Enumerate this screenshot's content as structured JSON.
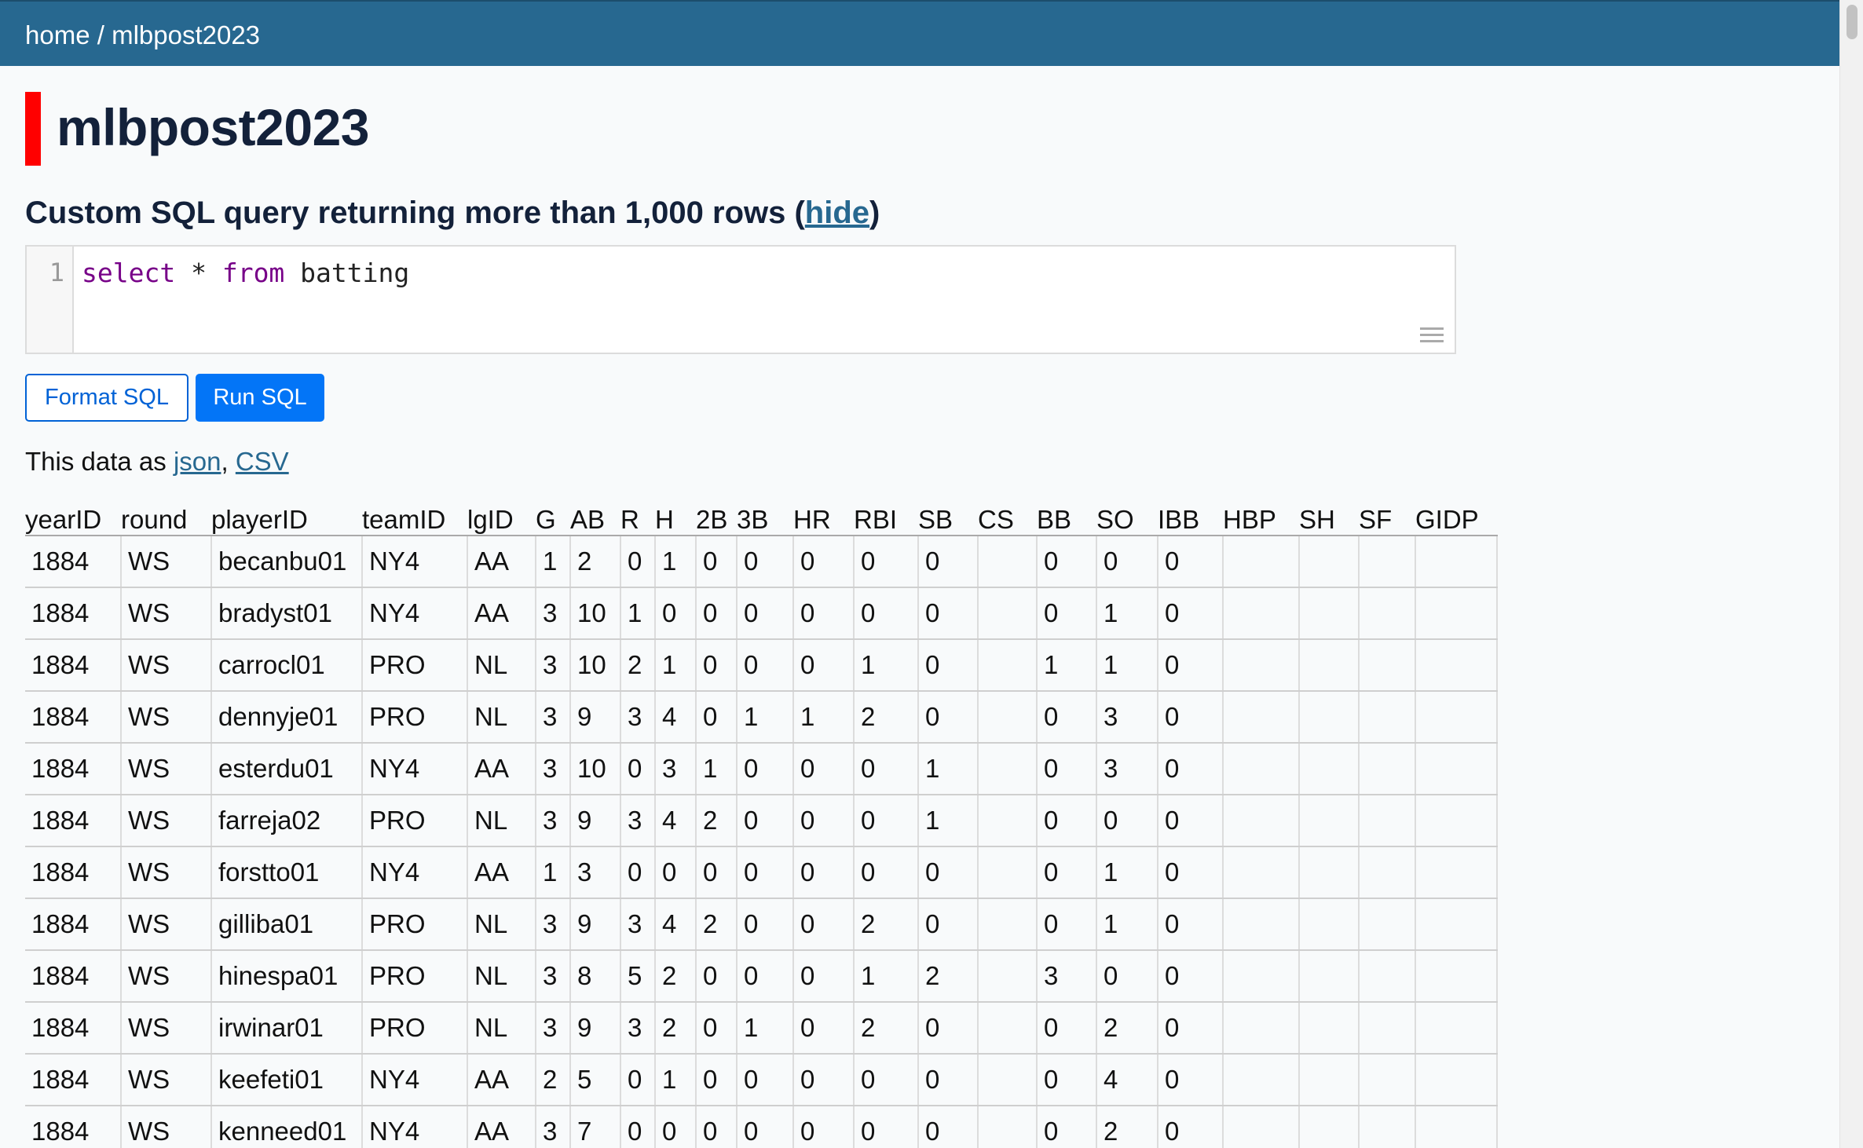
{
  "breadcrumb": {
    "home": "home",
    "separator": " / ",
    "current": "mlbpost2023"
  },
  "page": {
    "title": "mlbpost2023"
  },
  "query": {
    "heading": "Custom SQL query returning more than 1,000 rows (",
    "hide_label": "hide",
    "heading_end": ")",
    "line_number": "1",
    "sql_keyword_select": "select",
    "sql_star": " * ",
    "sql_keyword_from": "from",
    "sql_table": " batting"
  },
  "buttons": {
    "format": "Format SQL",
    "run": "Run SQL"
  },
  "export": {
    "prefix": "This data as ",
    "json": "json",
    "comma": ", ",
    "csv": "CSV"
  },
  "table": {
    "columns": [
      "yearID",
      "round",
      "playerID",
      "teamID",
      "lgID",
      "G",
      "AB",
      "R",
      "H",
      "2B",
      "3B",
      "HR",
      "RBI",
      "SB",
      "CS",
      "BB",
      "SO",
      "IBB",
      "HBP",
      "SH",
      "SF",
      "GIDP"
    ],
    "rows": [
      [
        "1884",
        "WS",
        "becanbu01",
        "NY4",
        "AA",
        "1",
        "2",
        "0",
        "1",
        "0",
        "0",
        "0",
        "0",
        "0",
        "",
        "0",
        "0",
        "0",
        "",
        "",
        "",
        ""
      ],
      [
        "1884",
        "WS",
        "bradyst01",
        "NY4",
        "AA",
        "3",
        "10",
        "1",
        "0",
        "0",
        "0",
        "0",
        "0",
        "0",
        "",
        "0",
        "1",
        "0",
        "",
        "",
        "",
        ""
      ],
      [
        "1884",
        "WS",
        "carrocl01",
        "PRO",
        "NL",
        "3",
        "10",
        "2",
        "1",
        "0",
        "0",
        "0",
        "1",
        "0",
        "",
        "1",
        "1",
        "0",
        "",
        "",
        "",
        ""
      ],
      [
        "1884",
        "WS",
        "dennyje01",
        "PRO",
        "NL",
        "3",
        "9",
        "3",
        "4",
        "0",
        "1",
        "1",
        "2",
        "0",
        "",
        "0",
        "3",
        "0",
        "",
        "",
        "",
        ""
      ],
      [
        "1884",
        "WS",
        "esterdu01",
        "NY4",
        "AA",
        "3",
        "10",
        "0",
        "3",
        "1",
        "0",
        "0",
        "0",
        "1",
        "",
        "0",
        "3",
        "0",
        "",
        "",
        "",
        ""
      ],
      [
        "1884",
        "WS",
        "farreja02",
        "PRO",
        "NL",
        "3",
        "9",
        "3",
        "4",
        "2",
        "0",
        "0",
        "0",
        "1",
        "",
        "0",
        "0",
        "0",
        "",
        "",
        "",
        ""
      ],
      [
        "1884",
        "WS",
        "forstto01",
        "NY4",
        "AA",
        "1",
        "3",
        "0",
        "0",
        "0",
        "0",
        "0",
        "0",
        "0",
        "",
        "0",
        "1",
        "0",
        "",
        "",
        "",
        ""
      ],
      [
        "1884",
        "WS",
        "gilliba01",
        "PRO",
        "NL",
        "3",
        "9",
        "3",
        "4",
        "2",
        "0",
        "0",
        "2",
        "0",
        "",
        "0",
        "1",
        "0",
        "",
        "",
        "",
        ""
      ],
      [
        "1884",
        "WS",
        "hinespa01",
        "PRO",
        "NL",
        "3",
        "8",
        "5",
        "2",
        "0",
        "0",
        "0",
        "1",
        "2",
        "",
        "3",
        "0",
        "0",
        "",
        "",
        "",
        ""
      ],
      [
        "1884",
        "WS",
        "irwinar01",
        "PRO",
        "NL",
        "3",
        "9",
        "3",
        "2",
        "0",
        "1",
        "0",
        "2",
        "0",
        "",
        "0",
        "2",
        "0",
        "",
        "",
        "",
        ""
      ],
      [
        "1884",
        "WS",
        "keefeti01",
        "NY4",
        "AA",
        "2",
        "5",
        "0",
        "1",
        "0",
        "0",
        "0",
        "0",
        "0",
        "",
        "0",
        "4",
        "0",
        "",
        "",
        "",
        ""
      ],
      [
        "1884",
        "WS",
        "kenneed01",
        "NY4",
        "AA",
        "3",
        "7",
        "0",
        "0",
        "0",
        "0",
        "0",
        "0",
        "0",
        "",
        "0",
        "2",
        "0",
        "",
        "",
        "",
        ""
      ]
    ]
  }
}
